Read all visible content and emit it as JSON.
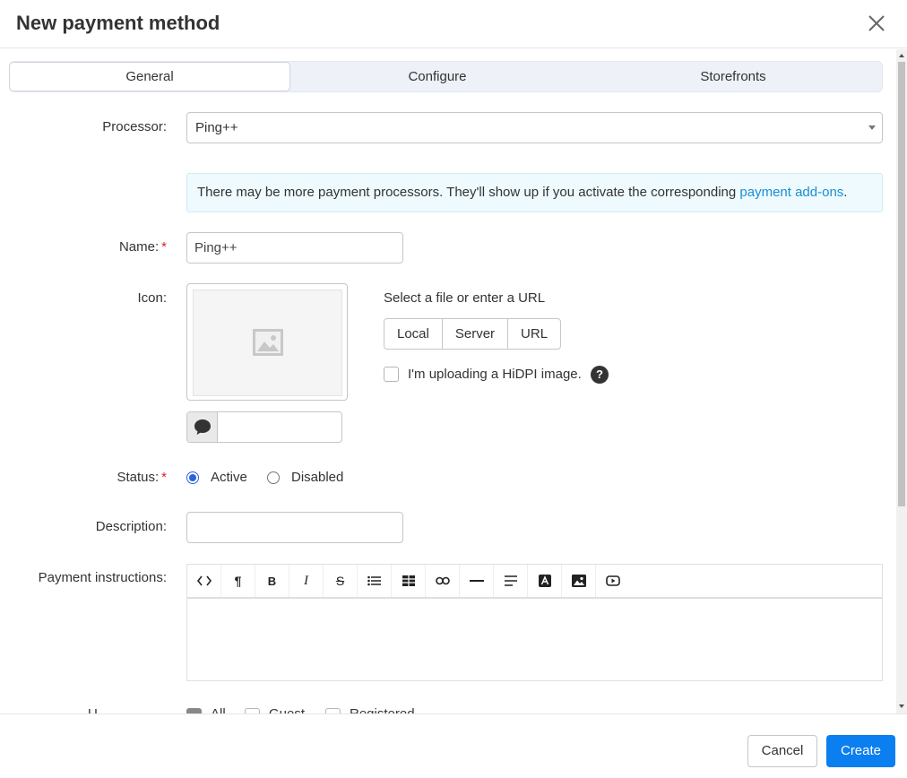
{
  "dialog": {
    "title": "New payment method"
  },
  "tabs": [
    {
      "label": "General",
      "active": true
    },
    {
      "label": "Configure",
      "active": false
    },
    {
      "label": "Storefronts",
      "active": false
    }
  ],
  "form": {
    "processor": {
      "label": "Processor:",
      "value": "Ping++"
    },
    "info": {
      "text": "There may be more payment processors. They'll show up if you activate the corresponding ",
      "link": "payment add-ons",
      "tail": "."
    },
    "name": {
      "label": "Name:",
      "required_mark": "*",
      "value": "Ping++"
    },
    "icon": {
      "label": "Icon:",
      "select_text": "Select a file or enter a URL",
      "sources": [
        "Local",
        "Server",
        "URL"
      ],
      "hidpi_label": "I'm uploading a HiDPI image.",
      "hidpi_checked": false,
      "help": "?",
      "alt_value": ""
    },
    "status": {
      "label": "Status:",
      "required_mark": "*",
      "options": [
        "Active",
        "Disabled"
      ],
      "selected": "Active"
    },
    "description": {
      "label": "Description:",
      "value": ""
    },
    "payment_instructions": {
      "label": "Payment instructions:",
      "toolbar": [
        "code-view",
        "paragraph",
        "bold",
        "italic",
        "strikethrough",
        "list",
        "table",
        "link",
        "horizontal-rule",
        "align",
        "font-color",
        "image",
        "video"
      ]
    },
    "usergroups_partial": {
      "label": "U",
      "options": [
        "All",
        "Guest",
        "Registered"
      ]
    }
  },
  "footer": {
    "cancel": "Cancel",
    "create": "Create"
  },
  "colors": {
    "primary": "#0b7ef0",
    "link": "#1a8fd4",
    "required": "#e02020",
    "radio": "#2a62d9"
  }
}
